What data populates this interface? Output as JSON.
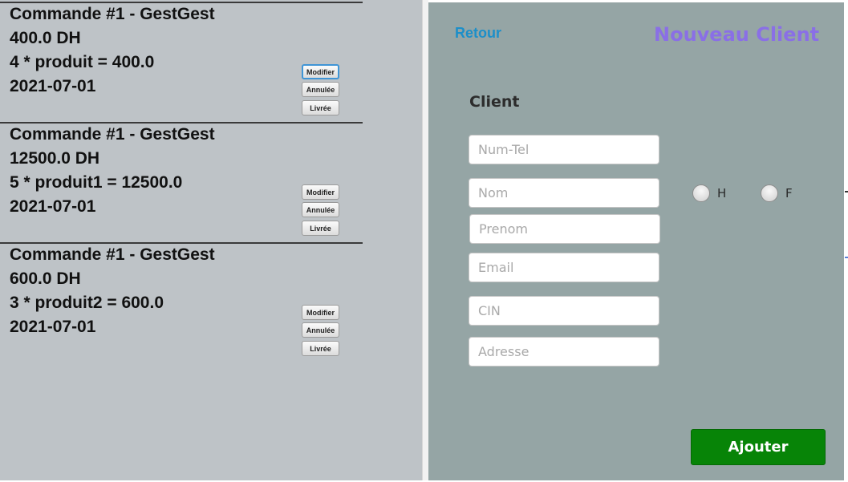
{
  "orders": [
    {
      "title": "Commande #1 - GestGest",
      "amount": "400.0 DH",
      "detail": "4 * produit = 400.0",
      "date": "2021-07-01",
      "modify_label": "Modifier",
      "cancel_label": "Annulée",
      "deliver_label": "Livrée"
    },
    {
      "title": "Commande #1 - GestGest",
      "amount": "12500.0 DH",
      "detail": "5 * produit1 = 12500.0",
      "date": "2021-07-01",
      "modify_label": "Modifier",
      "cancel_label": "Annulée",
      "deliver_label": "Livrée"
    },
    {
      "title": "Commande #1 - GestGest",
      "amount": "600.0 DH",
      "detail": "3 * produit2 = 600.0",
      "date": "2021-07-01",
      "modify_label": "Modifier",
      "cancel_label": "Annulée",
      "deliver_label": "Livrée"
    }
  ],
  "form": {
    "back_label": "Retour",
    "title": "Nouveau Client",
    "section_label": "Client",
    "fields": {
      "phone": {
        "placeholder": "Num-Tel",
        "value": ""
      },
      "last_name": {
        "placeholder": "Nom",
        "value": ""
      },
      "first_name": {
        "placeholder": "Prenom",
        "value": ""
      },
      "email": {
        "placeholder": "Email",
        "value": ""
      },
      "cin": {
        "placeholder": "CIN",
        "value": ""
      },
      "address": {
        "placeholder": "Adresse",
        "value": ""
      }
    },
    "gender_options": {
      "male": "H",
      "female": "F"
    },
    "submit_label": "Ajouter"
  },
  "colors": {
    "left_panel_bg": "#bec3c7",
    "right_panel_bg": "#95a5a5",
    "back_link": "#1c8fc9",
    "form_title": "#8a6fe6",
    "submit_button": "#078407",
    "focus_ring": "#3f95d6"
  }
}
